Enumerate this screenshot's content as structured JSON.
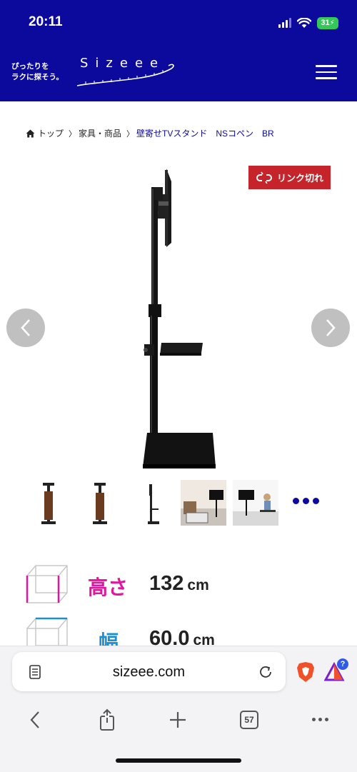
{
  "status_bar": {
    "time": "20:11",
    "battery": "31"
  },
  "site": {
    "tagline_line1": "ぴったりを",
    "tagline_line2": "ラクに探そう。",
    "logo_text": "Sizeee"
  },
  "breadcrumb": {
    "items": [
      "トップ",
      "家具・商品",
      "壁寄せTVスタンド　NSコペン　BR"
    ],
    "separator": "〉"
  },
  "badge": {
    "label": "リンク切れ"
  },
  "specs": [
    {
      "label": "高さ",
      "value": "132",
      "unit": "cm",
      "color": "#e0169c"
    },
    {
      "label": "幅",
      "value": "60.0",
      "unit": "cm",
      "color": "#1a8fd6"
    }
  ],
  "browser": {
    "url": "sizeee.com",
    "tab_count": "57",
    "notification_badge": "?"
  },
  "colors": {
    "brand_blue": "#0b0a9c",
    "badge_red": "#c5242b",
    "height_pink": "#e0169c",
    "width_blue": "#1a8fd6"
  }
}
